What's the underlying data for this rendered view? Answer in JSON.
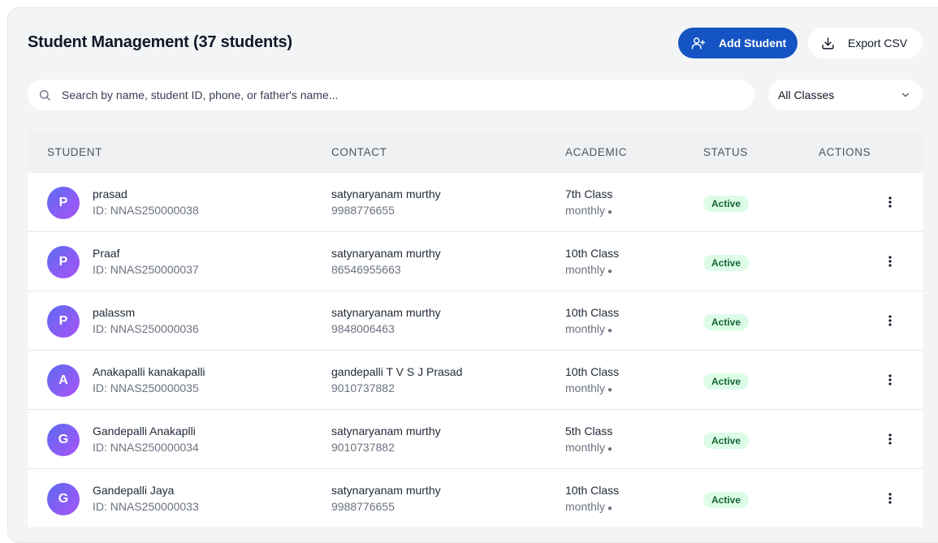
{
  "header": {
    "title": "Student Management (37 students)",
    "add_label": "Add Student",
    "export_label": "Export CSV"
  },
  "search": {
    "placeholder": "Search by name, student ID, phone, or father's name..."
  },
  "filter": {
    "selected": "All Classes"
  },
  "table": {
    "headers": [
      "STUDENT",
      "CONTACT",
      "ACADEMIC",
      "STATUS",
      "ACTIONS"
    ],
    "rows": [
      {
        "initial": "P",
        "name": "prasad",
        "id": "ID: NNAS250000038",
        "contact_name": "satynaryanam murthy",
        "phone": "9988776655",
        "class": "7th Class",
        "plan": "monthly",
        "status": "Active"
      },
      {
        "initial": "P",
        "name": "Praaf",
        "id": "ID: NNAS250000037",
        "contact_name": "satynaryanam murthy",
        "phone": "86546955663",
        "class": "10th Class",
        "plan": "monthly",
        "status": "Active"
      },
      {
        "initial": "P",
        "name": "palassm",
        "id": "ID: NNAS250000036",
        "contact_name": "satynaryanam murthy",
        "phone": "9848006463",
        "class": "10th Class",
        "plan": "monthly",
        "status": "Active"
      },
      {
        "initial": "A",
        "name": "Anakapalli kanakapalli",
        "id": "ID: NNAS250000035",
        "contact_name": "gandepalli T V S J Prasad",
        "phone": "9010737882",
        "class": "10th Class",
        "plan": "monthly",
        "status": "Active"
      },
      {
        "initial": "G",
        "name": "Gandepalli Anakaplli",
        "id": "ID: NNAS250000034",
        "contact_name": "satynaryanam murthy",
        "phone": "9010737882",
        "class": "5th Class",
        "plan": "monthly",
        "status": "Active"
      },
      {
        "initial": "G",
        "name": "Gandepalli Jaya",
        "id": "ID: NNAS250000033",
        "contact_name": "satynaryanam murthy",
        "phone": "9988776655",
        "class": "10th Class",
        "plan": "monthly",
        "status": "Active"
      }
    ]
  },
  "icons": {
    "add_user": "user-plus-icon",
    "export": "download-icon",
    "search": "search-icon",
    "dropdown": "chevron-down-icon",
    "actions": "more-vertical-icon"
  },
  "colors": {
    "primary": "#1554c3",
    "status_active_bg": "#dcfce7",
    "status_active_text": "#166534"
  }
}
